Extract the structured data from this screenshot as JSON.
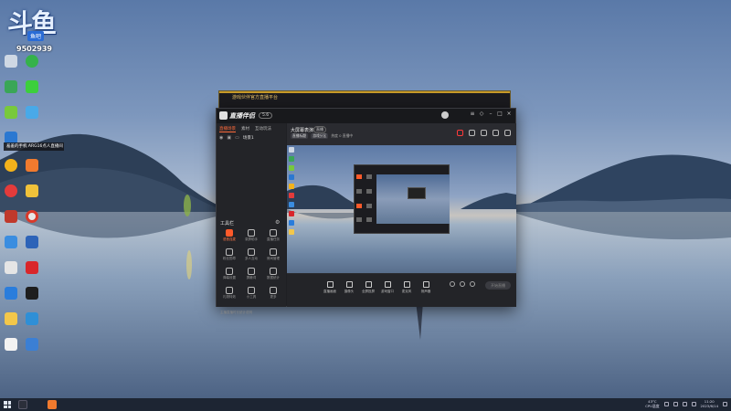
{
  "desktop": {
    "logo_text": "斗鱼",
    "logo_badge": "鱼吧",
    "room_number": "9502939",
    "notification": "羞羞的手机 ARG16点人直播间"
  },
  "back_window": {
    "title": "游戏伙伴官方直播平台"
  },
  "app": {
    "name": "直播伴侣",
    "tag": "5.6",
    "sidebar": {
      "tabs": [
        "直播场景",
        "素材",
        "互动玩法"
      ],
      "scene_label": "场景1",
      "tools_title": "工具栏",
      "tools": [
        {
          "label": "语音连麦",
          "icon": "mic-icon",
          "active": true
        },
        {
          "label": "录屏助手",
          "icon": "record-icon",
          "active": false
        },
        {
          "label": "直播任务",
          "icon": "task-icon",
          "active": false
        },
        {
          "label": "粉丝勋章",
          "icon": "medal-icon",
          "active": false
        },
        {
          "label": "多人互动",
          "icon": "multi-icon",
          "active": false
        },
        {
          "label": "房间管理",
          "icon": "room-icon",
          "active": false
        },
        {
          "label": "弹幕设置",
          "icon": "danmaku-icon",
          "active": false
        },
        {
          "label": "屏蔽词",
          "icon": "block-icon",
          "active": false
        },
        {
          "label": "数据统计",
          "icon": "stats-icon",
          "active": false
        },
        {
          "label": "礼物特效",
          "icon": "gift-icon",
          "active": false
        },
        {
          "label": "小工具",
          "icon": "widget-icon",
          "active": false
        },
        {
          "label": "更多",
          "icon": "more-icon",
          "active": false
        }
      ],
      "footer": "主播直播时长统计说明"
    },
    "room": {
      "title": "大屏幕表演",
      "badge": "直播",
      "chips": [
        "直播标题",
        "游戏分区"
      ],
      "meta": "热度 0  直播中"
    },
    "bottom_bar": {
      "items": [
        {
          "label": "直播画面",
          "icon": "screen-icon"
        },
        {
          "label": "摄像头",
          "icon": "camera-icon"
        },
        {
          "label": "全屏投屏",
          "icon": "cast-icon"
        },
        {
          "label": "游戏窗口",
          "icon": "window-icon"
        },
        {
          "label": "麦克风",
          "icon": "mic-icon"
        },
        {
          "label": "扬声器",
          "icon": "speaker-icon"
        }
      ],
      "start_live": "开始直播"
    }
  },
  "taskbar": {
    "tray_text": "43°C\nCPU温度",
    "clock": "11:20\n2023/6/14"
  }
}
